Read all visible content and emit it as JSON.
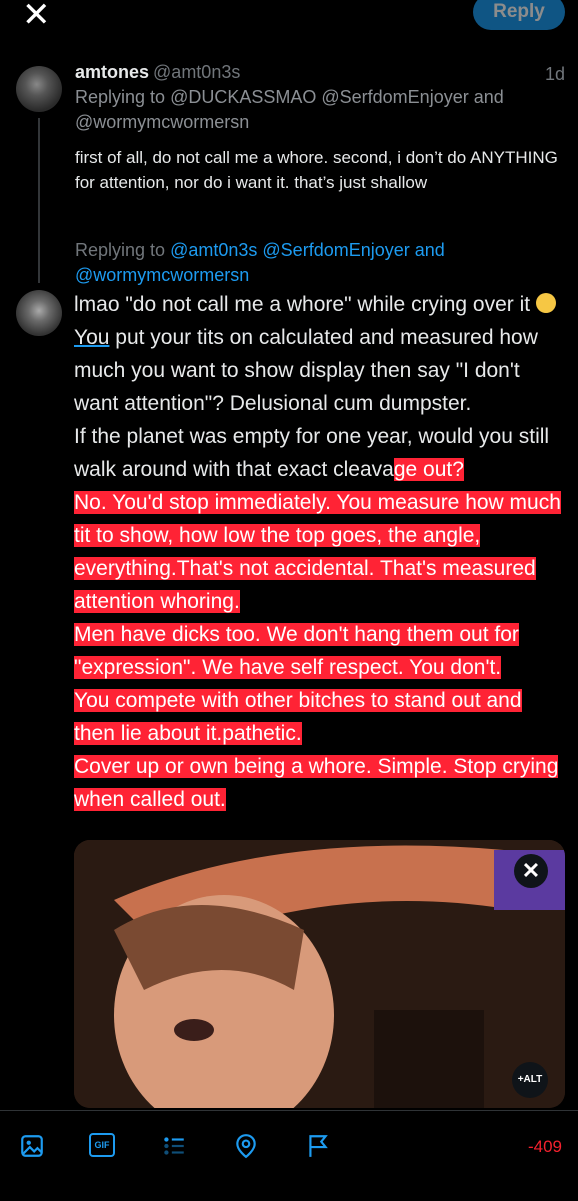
{
  "header": {
    "reply_label": "Reply"
  },
  "tweet1": {
    "name": "amtones",
    "handle": "@amt0n3s",
    "time": "1d",
    "replying_prefix": "Replying to",
    "replying_mentions": "@DUCKASSMAO @SerfdomEnjoyer and @wormymcwormersn",
    "body": "first of all, do not call me a whore. second, i don’t do ANYTHING for attention, nor do i want it. that’s just shallow"
  },
  "reply": {
    "replying_prefix": "Replying to",
    "mention_1": "@amt0n3s",
    "mention_2": "@SerfdomEnjoyer",
    "and_word": "and",
    "mention_3": "@wormymcwormersn",
    "text_plain_1": "lmao \"do not call me a whore\" while crying over it ",
    "emoji": "😂",
    "text_link": "You",
    "text_plain_2": " put your tits on calculated and measured how much you want to show display then say \"I don't want attention\"? Delusional cum dumpster.",
    "text_plain_3": "If the planet was empty for one year, would you still walk around with that exact cleava",
    "hl_1": "ge out?",
    "hl_2": "No. You'd stop immediately. You measure how much tit to show, how low the top goes, the angle, everything.That's not accidental. That's measured attention whoring.",
    "hl_3": "Men have dicks too. We don't hang them out for \"expression\". We have self respect. You don't.",
    "hl_4": "You compete with other bitches to stand out and then lie about it.pathetic.",
    "hl_5": "Cover up or own being a whore. Simple. Stop crying when called out."
  },
  "media": {
    "close_glyph": "✕",
    "alt_label": "+ALT"
  },
  "toolbar": {
    "icons": [
      "image-icon",
      "gif-icon",
      "poll-icon",
      "location-icon",
      "flag-icon"
    ],
    "gif_label": "GIF",
    "char_counter": "-409"
  },
  "colors": {
    "accent": "#1d9bf0",
    "highlight": "#ff2335",
    "counter": "#f4212e"
  }
}
